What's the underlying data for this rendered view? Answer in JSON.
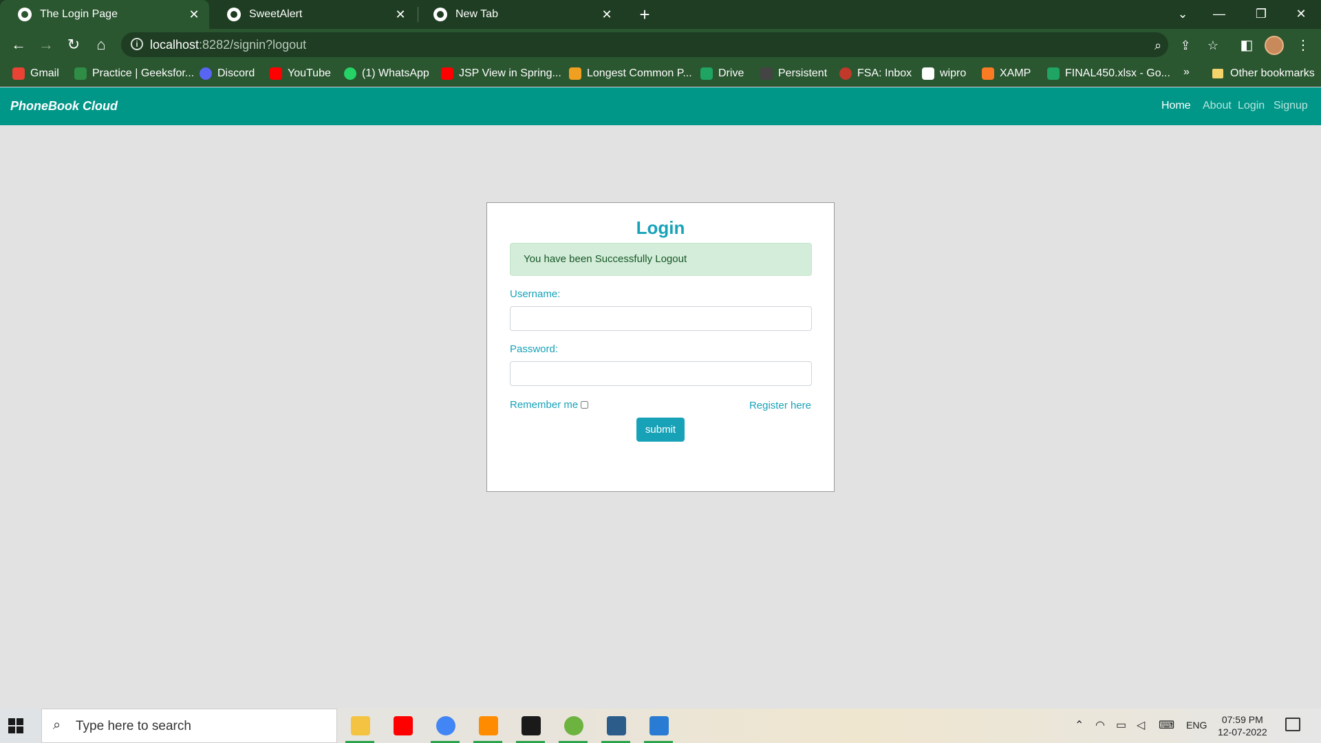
{
  "browser": {
    "tabs": [
      {
        "title": "The Login Page",
        "active": true
      },
      {
        "title": "SweetAlert",
        "active": false
      },
      {
        "title": "New Tab",
        "active": false
      }
    ],
    "url": {
      "host": "localhost",
      "rest": ":8282/signin?logout"
    },
    "bookmarks": [
      {
        "label": "Gmail",
        "color": "#ea4335"
      },
      {
        "label": "Practice | Geeksfor...",
        "color": "#2f8d46"
      },
      {
        "label": "Discord",
        "color": "#5865f2"
      },
      {
        "label": "YouTube",
        "color": "#ff0000"
      },
      {
        "label": "(1) WhatsApp",
        "color": "#25d366"
      },
      {
        "label": "JSP View in Spring...",
        "color": "#ff0000"
      },
      {
        "label": "Longest Common P...",
        "color": "#f0a020"
      },
      {
        "label": "Drive",
        "color": "#1fa463"
      },
      {
        "label": "Persistent",
        "color": "#444444"
      },
      {
        "label": "FSA: Inbox",
        "color": "#c0392b"
      },
      {
        "label": "wipro",
        "color": "#ffffff"
      },
      {
        "label": "XAMP",
        "color": "#fb7a24"
      },
      {
        "label": "FINAL450.xlsx - Go...",
        "color": "#1fa463"
      }
    ],
    "bookmarks_more": "»",
    "other_bookmarks": "Other bookmarks"
  },
  "app": {
    "brand": "PhoneBook Cloud",
    "nav": [
      "Home",
      "About",
      "Login",
      "Signup"
    ],
    "accent_color": "#009688"
  },
  "login": {
    "title": "Login",
    "alert": "You have been Successfully Logout",
    "username_label": "Username:",
    "username_value": "",
    "password_label": "Password:",
    "password_value": "",
    "remember_label": "Remember me",
    "remember_checked": false,
    "register_link": "Register here",
    "submit_label": "submit"
  },
  "taskbar": {
    "search_placeholder": "Type here to search",
    "language": "ENG",
    "time": "07:59 PM",
    "date": "12-07-2022"
  }
}
